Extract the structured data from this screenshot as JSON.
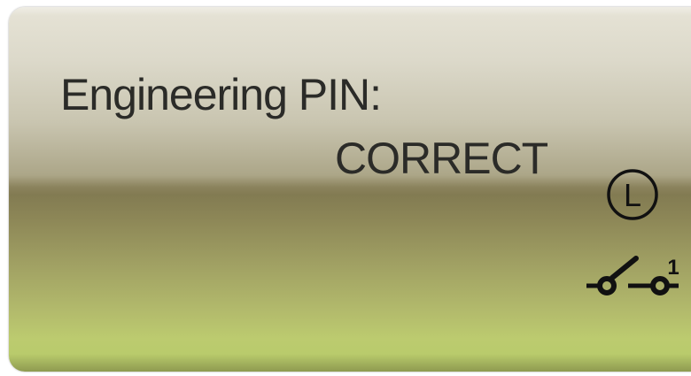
{
  "display": {
    "line1": "Engineering PIN:",
    "line2": "CORRECT"
  },
  "icons": {
    "lock_indicator": "L",
    "switch_indicator_number": "1",
    "lock_icon_name": "circled-l-icon",
    "switch_icon_name": "switch-icon"
  },
  "colors": {
    "text": "#2b2b28",
    "lcd_top": "#e6e3d6",
    "lcd_bottom": "#bccb6f"
  }
}
